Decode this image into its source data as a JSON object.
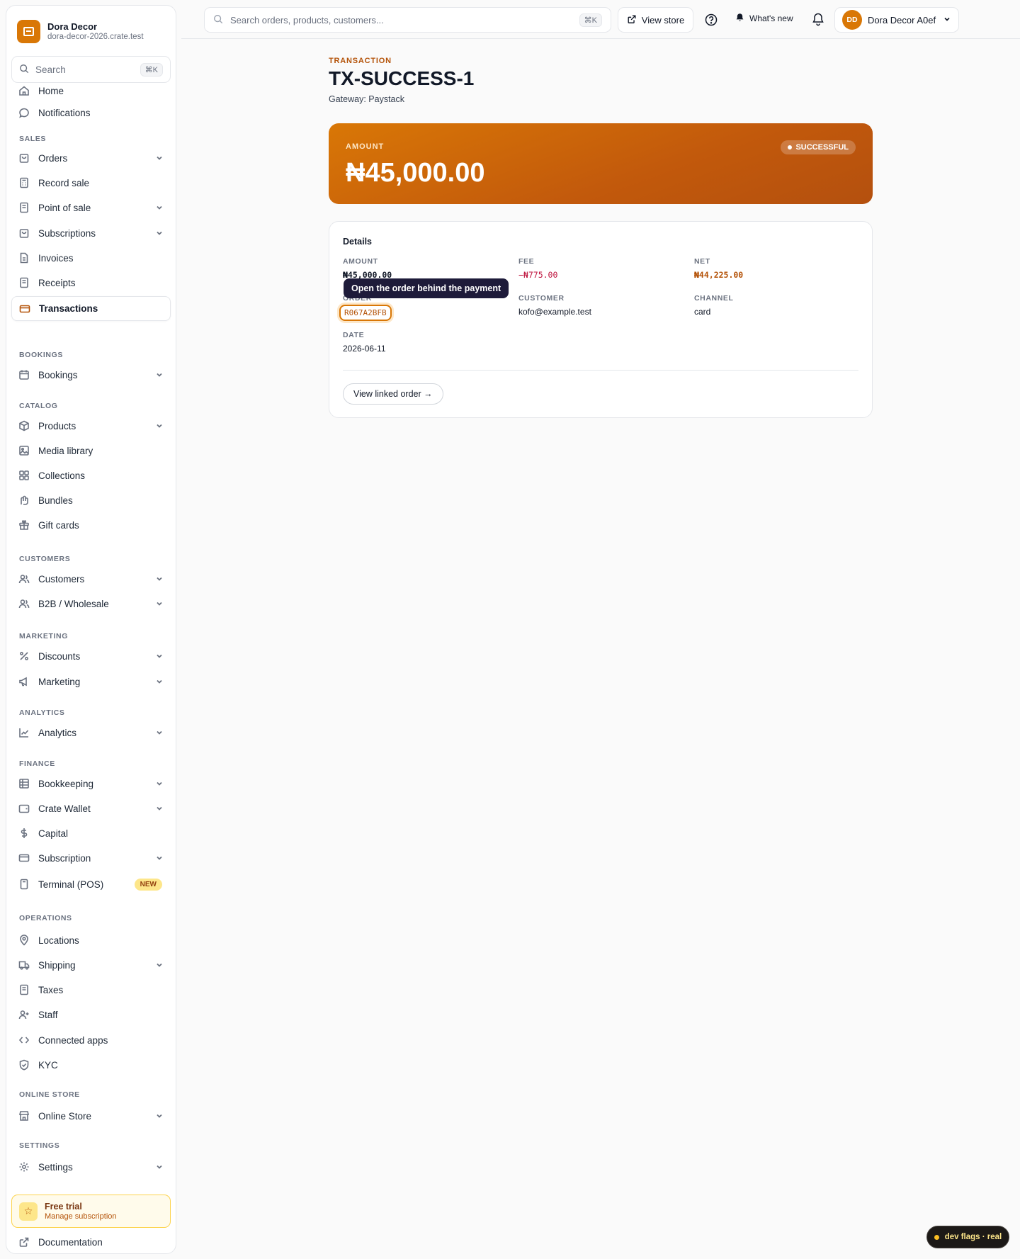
{
  "brand": {
    "name": "Dora Decor",
    "domain": "dora-decor-2026.crate.test"
  },
  "sidebar": {
    "search_placeholder": "Search",
    "search_shortcut": "⌘K",
    "sections": {
      "sales": "SALES",
      "bookings": "BOOKINGS",
      "catalog": "CATALOG",
      "customers": "CUSTOMERS",
      "marketing": "MARKETING",
      "analytics": "ANALYTICS",
      "finance": "FINANCE",
      "operations": "OPERATIONS",
      "online_store": "ONLINE STORE",
      "settings": "SETTINGS"
    },
    "items": {
      "home": "Home",
      "notifications": "Notifications",
      "orders": "Orders",
      "record_sale": "Record sale",
      "point_of_sale": "Point of sale",
      "subscriptions": "Subscriptions",
      "invoices": "Invoices",
      "receipts": "Receipts",
      "transactions": "Transactions",
      "bookings": "Bookings",
      "products": "Products",
      "media_library": "Media library",
      "collections": "Collections",
      "bundles": "Bundles",
      "gift_cards": "Gift cards",
      "customers": "Customers",
      "b2b": "B2B / Wholesale",
      "discounts": "Discounts",
      "marketing": "Marketing",
      "analytics": "Analytics",
      "bookkeeping": "Bookkeeping",
      "crate_wallet": "Crate Wallet",
      "capital": "Capital",
      "subscription": "Subscription",
      "terminal": "Terminal (POS)",
      "terminal_badge": "NEW",
      "locations": "Locations",
      "shipping": "Shipping",
      "taxes": "Taxes",
      "staff": "Staff",
      "connected_apps": "Connected apps",
      "kyc": "KYC",
      "online_store": "Online Store",
      "settings": "Settings"
    },
    "trial": {
      "title": "Free trial",
      "subtitle": "Manage subscription"
    },
    "documentation": "Documentation"
  },
  "topbar": {
    "search_placeholder": "Search orders, products, customers...",
    "search_shortcut": "⌘K",
    "view_store": "View store",
    "whats_new": "What's new",
    "user_initials": "DD",
    "user_name": "Dora Decor A0ef"
  },
  "transaction": {
    "eyebrow": "TRANSACTION",
    "title": "TX-SUCCESS-1",
    "gateway": "Gateway: Paystack",
    "amount_label": "AMOUNT",
    "amount_value": "₦45,000.00",
    "status": "SUCCESSFUL",
    "details_title": "Details",
    "fields": {
      "amount_label": "AMOUNT",
      "amount_value": "₦45,000.00",
      "fee_label": "FEE",
      "fee_value": "−₦775.00",
      "net_label": "NET",
      "net_value": "₦44,225.00",
      "order_label": "ORDER",
      "order_value": "R067A2BFB",
      "customer_label": "CUSTOMER",
      "customer_value": "kofo@example.test",
      "channel_label": "CHANNEL",
      "channel_value": "card",
      "date_label": "DATE",
      "date_value": "2026-06-11"
    },
    "tooltip": "Open the order behind the payment",
    "linked_order_button": "View linked order →"
  },
  "dev_flags": "dev flags · real",
  "colors": {
    "accent": "#d97706",
    "accent_dark": "#b45309",
    "fee_negative": "#be123c"
  }
}
